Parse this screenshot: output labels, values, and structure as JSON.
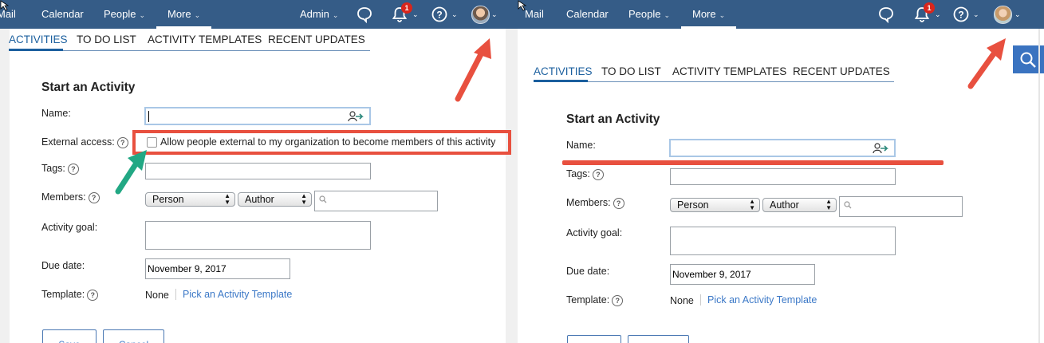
{
  "nav": {
    "mail": "Mail",
    "calendar": "Calendar",
    "people": "People",
    "more": "More",
    "admin": "Admin",
    "notification_count": "1"
  },
  "tabs": [
    "ACTIVITIES",
    "TO DO LIST",
    "ACTIVITY TEMPLATES",
    "RECENT UPDATES"
  ],
  "form": {
    "heading": "Start an Activity",
    "name_label": "Name:",
    "external_label": "External access:",
    "external_checkbox": "Allow people external to my organization to become members of this activity",
    "tags_label": "Tags:",
    "members_label": "Members:",
    "member_type": "Person",
    "member_role": "Author",
    "goal_label": "Activity goal:",
    "due_label": "Due date:",
    "due_value": "November 9, 2017",
    "template_label": "Template:",
    "template_value": "None",
    "template_link": "Pick an Activity Template",
    "help_glyph": "?"
  },
  "buttons": {
    "save": "Save",
    "cancel": "Cancel"
  },
  "annotation_colors": {
    "red": "#e8503f",
    "teal": "#22a884"
  }
}
